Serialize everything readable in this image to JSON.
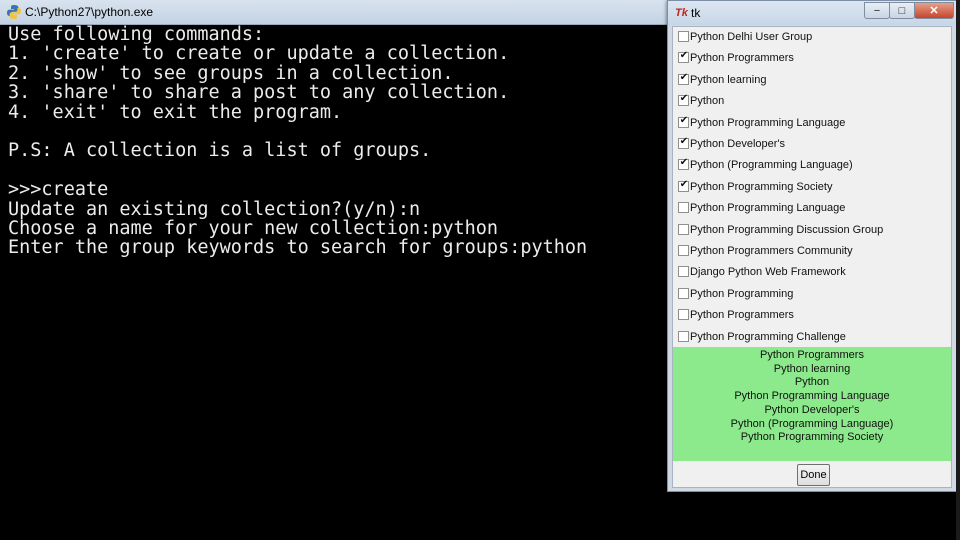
{
  "console": {
    "title": "C:\\Python27\\python.exe",
    "lines": [
      "Use following commands:",
      "1. 'create' to create or update a collection.",
      "2. 'show' to see groups in a collection.",
      "3. 'share' to share a post to any collection.",
      "4. 'exit' to exit the program.",
      "",
      "P.S: A collection is a list of groups.",
      "",
      ">>>create",
      "Update an existing collection?(y/n):n",
      "Choose a name for your new collection:python",
      "Enter the group keywords to search for groups:python"
    ]
  },
  "tk_window": {
    "logo": "Tk",
    "title": "tk",
    "controls": {
      "minimize": "−",
      "maximize": "□",
      "close": "✕"
    },
    "groups": [
      {
        "label": "Python Delhi User Group",
        "checked": false
      },
      {
        "label": "Python Programmers",
        "checked": true
      },
      {
        "label": "Python learning",
        "checked": true
      },
      {
        "label": "Python",
        "checked": true
      },
      {
        "label": "Python Programming Language",
        "checked": true
      },
      {
        "label": "Python Developer's",
        "checked": true
      },
      {
        "label": "Python (Programming Language)",
        "checked": true
      },
      {
        "label": "Python Programming Society",
        "checked": true
      },
      {
        "label": "Python Programming Language",
        "checked": false
      },
      {
        "label": "Python Programming Discussion Group",
        "checked": false
      },
      {
        "label": "Python Programmers Community",
        "checked": false
      },
      {
        "label": "Django Python Web Framework",
        "checked": false
      },
      {
        "label": "Python Programming",
        "checked": false
      },
      {
        "label": "Python Programmers",
        "checked": false
      },
      {
        "label": "Python Programming Challenge",
        "checked": false
      }
    ],
    "selected": [
      "Python Programmers",
      "Python learning",
      "Python",
      "Python Programming Language",
      "Python Developer's",
      "Python (Programming Language)",
      "Python Programming Society"
    ],
    "done_label": "Done",
    "colors": {
      "selected_panel": "#8cea8c",
      "tk_logo": "#c0261b"
    }
  }
}
